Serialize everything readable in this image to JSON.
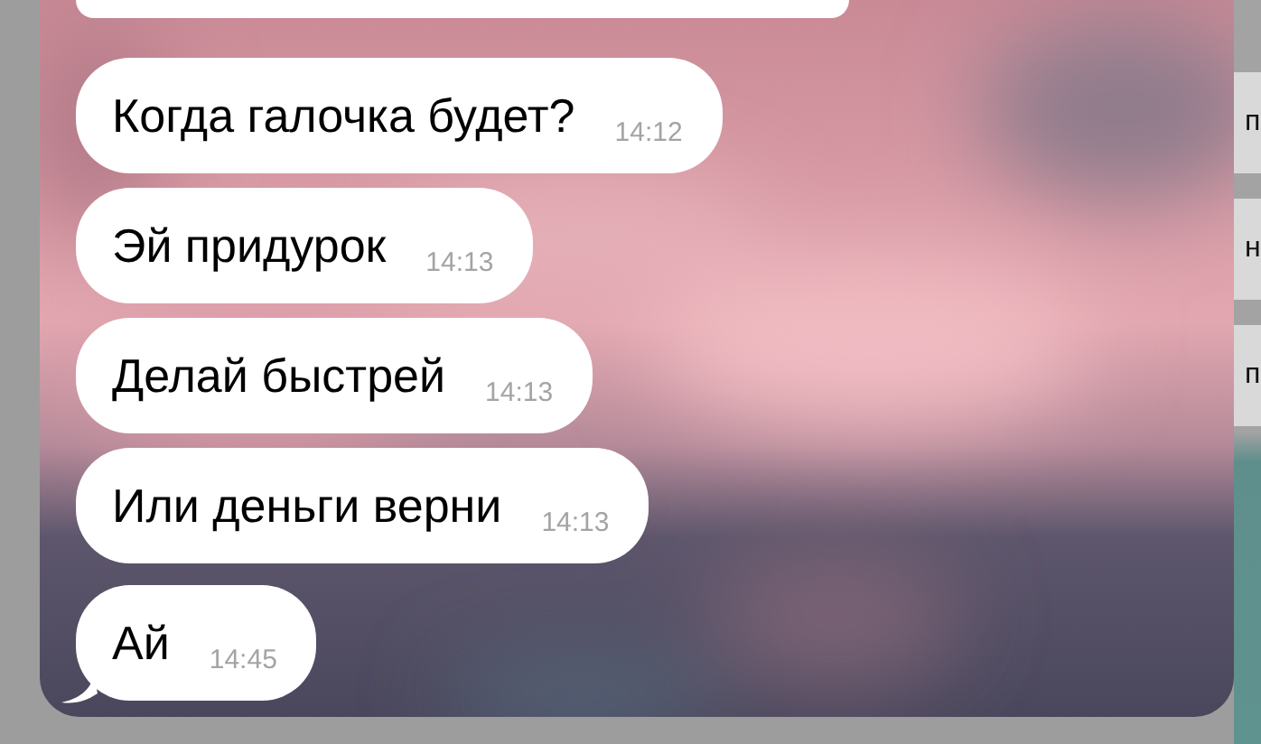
{
  "messages": [
    {
      "text": "Когда галочка будет?",
      "time": "14:12",
      "tail": false
    },
    {
      "text": "Эй придурок",
      "time": "14:13",
      "tail": false
    },
    {
      "text": "Делай быстрей",
      "time": "14:13",
      "tail": false
    },
    {
      "text": "Или деньги верни",
      "time": "14:13",
      "tail": false
    },
    {
      "text": "Ай",
      "time": "14:45",
      "tail": true
    }
  ],
  "side_list": [
    {
      "text": "п"
    },
    {
      "text": "н"
    },
    {
      "text": "п"
    }
  ]
}
